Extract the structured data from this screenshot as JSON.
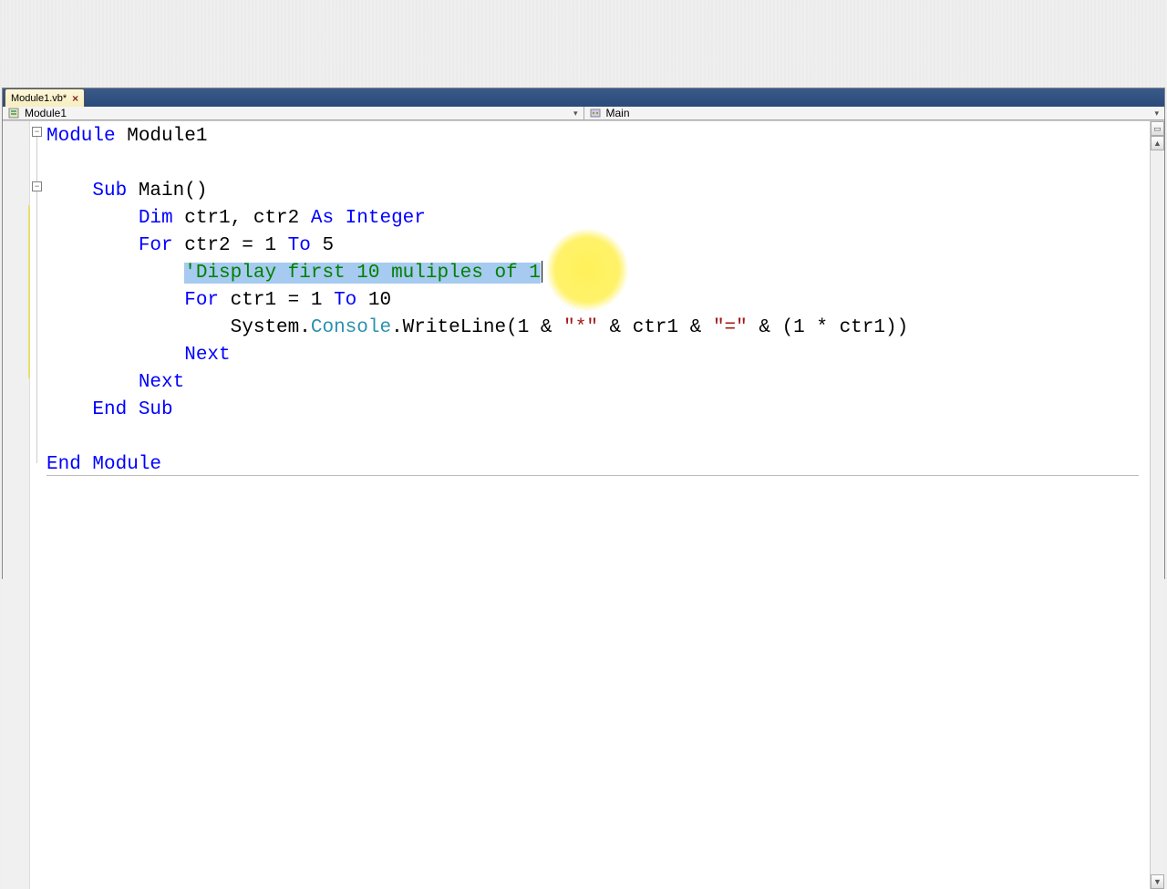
{
  "tab": {
    "label": "Module1.vb*",
    "close_glyph": "×"
  },
  "nav": {
    "left_label": "Module1",
    "right_label": "Main",
    "dropdown_glyph": "▾"
  },
  "fold": {
    "minus": "−"
  },
  "code": {
    "l1a": "Module",
    "l1b": " Module1",
    "l3a": "    Sub",
    "l3b": " Main()",
    "l4a": "        Dim",
    "l4b": " ctr1, ctr2 ",
    "l4c": "As Integer",
    "l5a": "        For",
    "l5b": " ctr2 = 1 ",
    "l5c": "To",
    "l5d": " 5",
    "l6pad": "            ",
    "l6cmt": "'Display first 10 muliples of 1",
    "l7a": "            For",
    "l7b": " ctr1 = 1 ",
    "l7c": "To",
    "l7d": " 10",
    "l8a": "                System.",
    "l8b": "Console",
    "l8c": ".WriteLine(1 & ",
    "l8d": "\"*\"",
    "l8e": " & ctr1 & ",
    "l8f": "\"=\"",
    "l8g": " & (1 * ctr1))",
    "l9a": "            Next",
    "l10a": "        Next",
    "l11a": "    End Sub",
    "l13a": "End Module"
  }
}
